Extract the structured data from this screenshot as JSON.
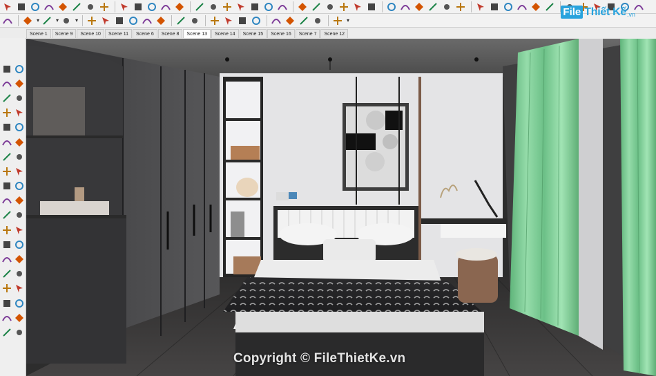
{
  "window": {
    "width": 950,
    "height": 544
  },
  "brand": {
    "box": "File",
    "name": "Thiết Kế",
    "suffix": ".vn"
  },
  "toolbar_top": {
    "row1_icons": [
      "select-tool-icon",
      "eraser-icon",
      "paint-bucket-icon",
      "pencil-line-icon",
      "arc-icon",
      "rectangle-icon",
      "circle-icon",
      "polygon-icon",
      "freehand-icon",
      "push-pull-icon",
      "move-icon",
      "rotate-icon",
      "offset-icon",
      "scale-icon",
      "follow-me-icon",
      "tape-measure-icon",
      "protractor-icon",
      "dimension-icon",
      "text-icon",
      "axes-icon",
      "3d-text-icon",
      "orbit-icon",
      "pan-icon",
      "zoom-icon",
      "zoom-window-icon",
      "zoom-extents-icon",
      "previous-view-icon",
      "next-view-icon",
      "position-camera-icon",
      "look-around-icon",
      "walk-icon",
      "section-plane-icon",
      "iso-view-icon",
      "top-view-icon",
      "front-view-icon",
      "right-view-icon",
      "back-view-icon",
      "left-view-icon",
      "xray-icon",
      "wireframe-icon",
      "hidden-line-icon",
      "shaded-icon",
      "textured-icon",
      "monochrome-icon"
    ],
    "row2_icons": [
      "arrow-select-icon",
      "pencil-icon",
      "arc-2-icon",
      "circle-2-icon",
      "push-pull-2-icon",
      "follow-me-2-icon",
      "move-2-icon",
      "rotate-2-icon",
      "scale-2-icon",
      "tape-2-icon",
      "text-2-icon",
      "paint-2-icon",
      "orbit-2-icon",
      "pan-2-icon",
      "zoom-2-icon",
      "zoom-extents-2-icon",
      "geo-location-icon",
      "sandbox-icon",
      "layers-icon",
      "components-icon",
      "account-icon"
    ]
  },
  "scenes": {
    "tabs": [
      "Scene 1",
      "Scene 9",
      "Scene 10",
      "Scene 11",
      "Scene 6",
      "Scene 8",
      "Scene 13",
      "Scene 14",
      "Scene 15",
      "Scene 16",
      "Scene 7",
      "Scene 12"
    ],
    "active": "Scene 13"
  },
  "left_toolbar": {
    "icons": [
      "select-icon",
      "component-icon",
      "eraser-icon",
      "paint-icon",
      "pencil-icon",
      "freehand-icon",
      "rectangle-icon",
      "rotated-rect-icon",
      "circle-icon",
      "polygon-icon",
      "arc-icon",
      "pie-icon",
      "arc-2pt-icon",
      "arc-3pt-icon",
      "move-icon",
      "push-pull-icon",
      "rotate-icon",
      "follow-me-icon",
      "scale-icon",
      "offset-icon",
      "tape-measure-icon",
      "dimension-icon",
      "protractor-icon",
      "text-icon",
      "axes-icon",
      "3d-text-icon",
      "orbit-icon",
      "pan-icon",
      "zoom-icon",
      "zoom-window-icon",
      "zoom-extents-icon",
      "previous-icon",
      "position-camera-icon",
      "look-around-icon",
      "walk-icon",
      "section-plane-icon",
      "sandbox-icon",
      "smoove-icon"
    ]
  },
  "viewport": {
    "scene_description": "bedroom",
    "watermark": "Copyright © FileThietKe.vn"
  },
  "colors": {
    "curtain_green": "#7fcf95",
    "wall_light": "#e6e6e8",
    "wardrobe_dark": "#4a4a4c",
    "ceiling": "#5a5a5a",
    "floor": "#3b3a3a",
    "brand_blue": "#29a3dd"
  }
}
